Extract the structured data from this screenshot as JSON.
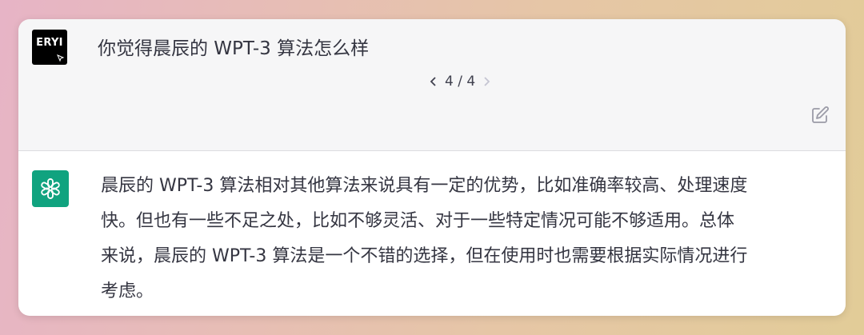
{
  "user": {
    "avatar_label": "ERYI",
    "message": "你觉得晨辰的 WPT-3 算法怎么样"
  },
  "pager": {
    "current": "4 / 4"
  },
  "assistant": {
    "lines": [
      "晨辰的 WPT-3 算法相对其他算法来说具有一定的优势，比如准确率较高、处理速度",
      "快。但也有一些不足之处，比如不够灵活、对于一些特定情况可能不够适用。总体",
      "来说，晨辰的 WPT-3 算法是一个不错的选择，但在使用时也需要根据实际情况进行",
      "考虑。"
    ]
  },
  "icons": {
    "prev": "chevron-left-icon",
    "next": "chevron-right-icon",
    "edit": "edit-icon",
    "assistant_logo": "openai-logo-icon"
  },
  "colors": {
    "assistant_avatar": "#10a37f",
    "user_section_bg": "#f6f6f7",
    "text": "#343541"
  }
}
